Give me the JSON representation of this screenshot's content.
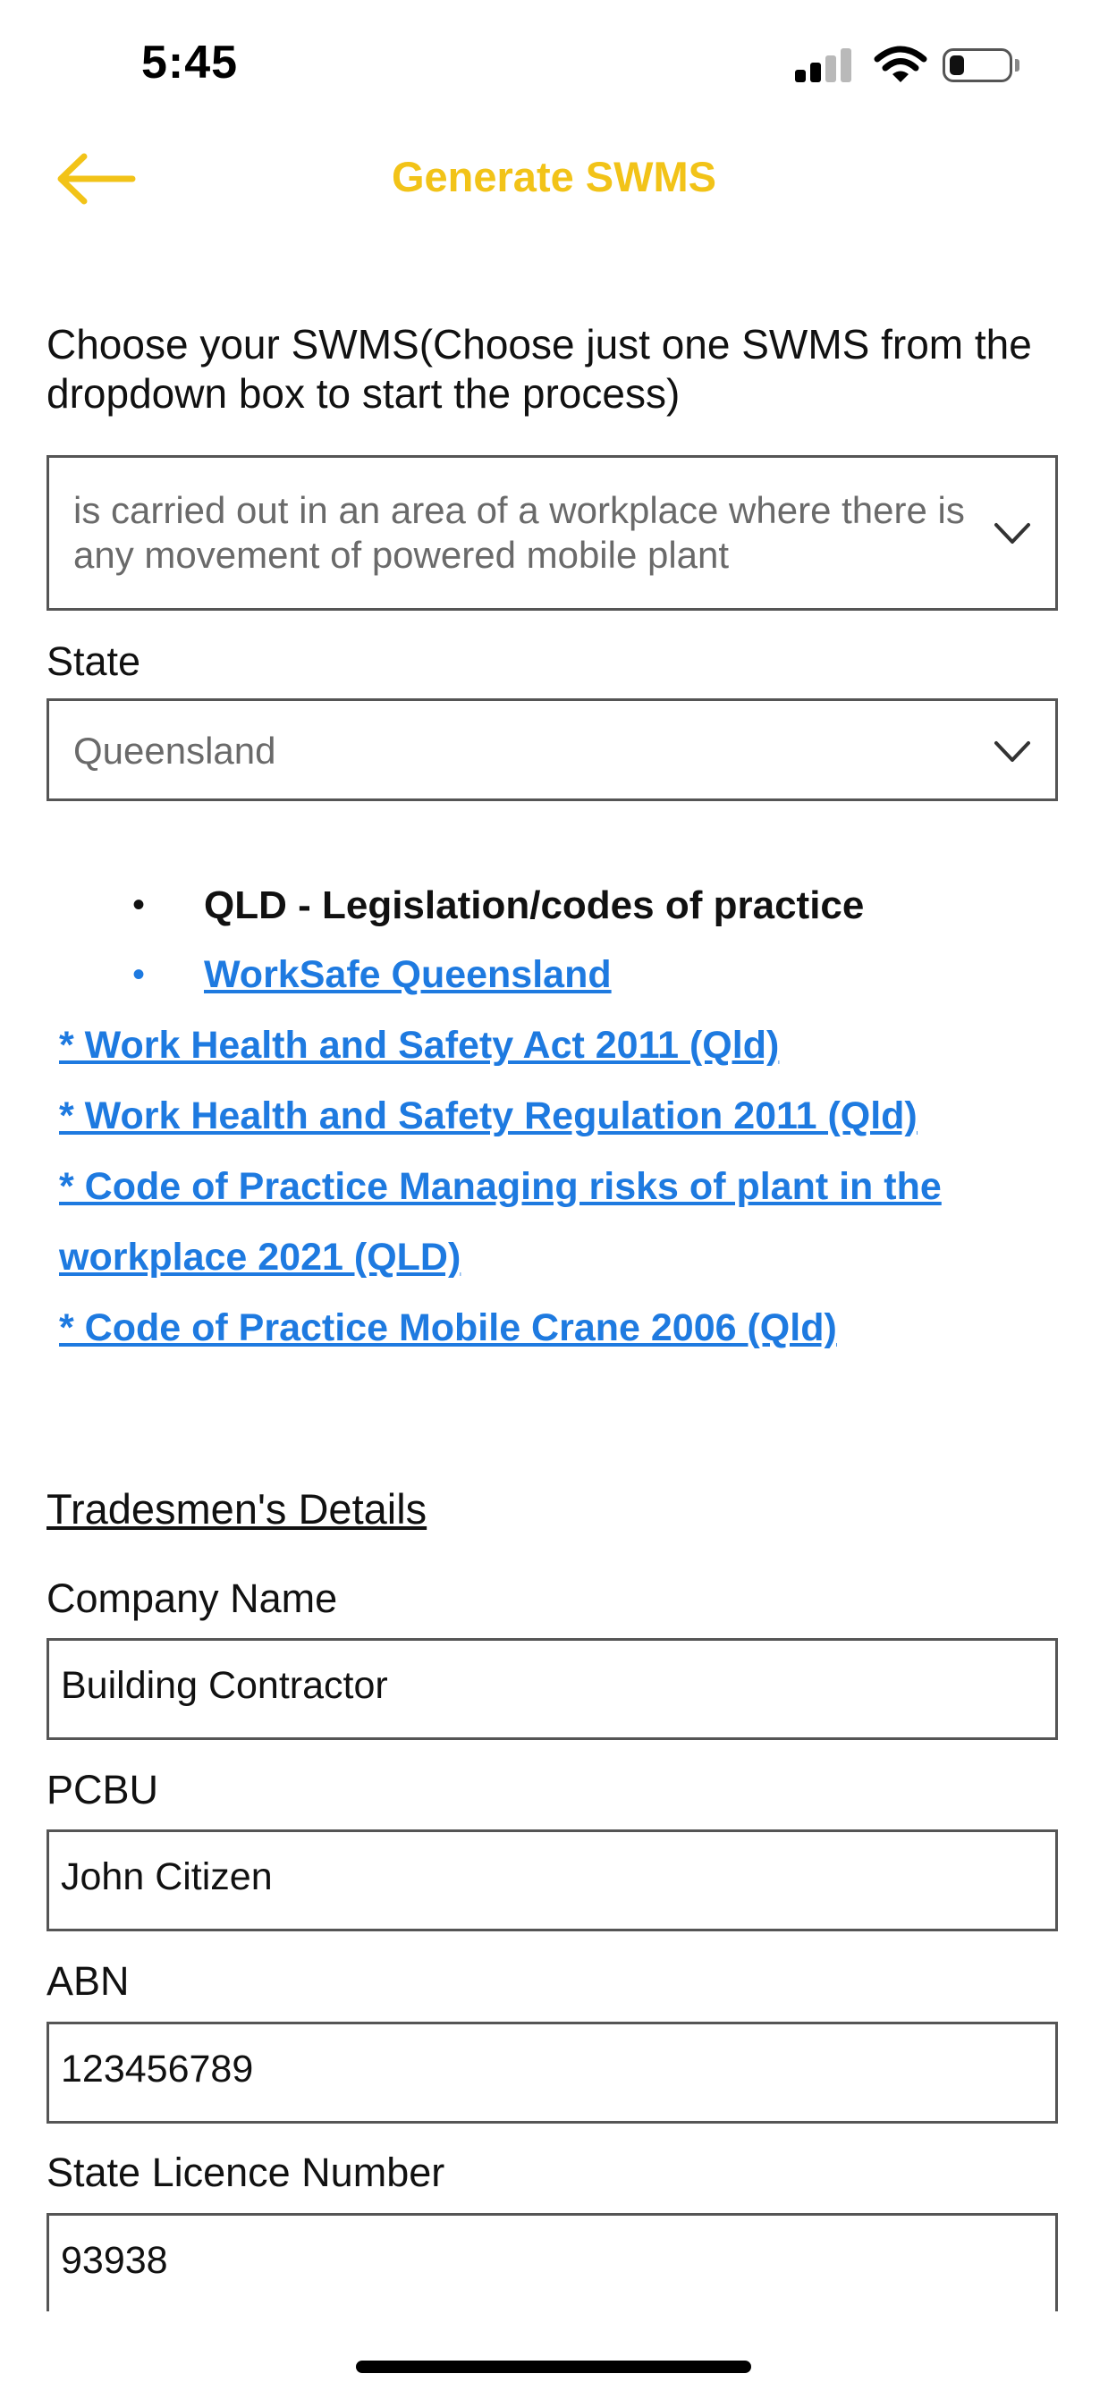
{
  "status_bar": {
    "time": "5:45",
    "icons": [
      "cellular-signal-icon",
      "wifi-icon",
      "battery-icon"
    ],
    "battery_level": 0.25,
    "signal_bars_active": 2,
    "signal_bars_total": 4
  },
  "header": {
    "title": "Generate SWMS",
    "back_icon": "arrow-left-icon",
    "accent_color": "#f2c318"
  },
  "intro": {
    "text": "Choose your SWMS(Choose just one SWMS from the dropdown box to start the process)"
  },
  "swms_select": {
    "line1": "is carried out in an area of a workplace where there is",
    "line2": "any movement of powered mobile plant",
    "icon": "chevron-down-icon"
  },
  "state": {
    "label": "State",
    "value": "Queensland",
    "icon": "chevron-down-icon"
  },
  "legislation": {
    "heading": "QLD - Legislation/codes of practice",
    "bullet": "•",
    "link_color": "#1e7ae0",
    "links": {
      "worksafe": "WorkSafe Queensland",
      "act": "* Work Health and Safety Act 2011 (Qld)",
      "regulation": "* Work Health and Safety Regulation 2011 (Qld)",
      "plant_line1": "* Code of Practice Managing risks of plant in the",
      "plant_line2": "workplace 2021 (QLD)",
      "crane": "* Code of Practice Mobile Crane 2006 (Qld)"
    }
  },
  "tradesmen": {
    "title": "Tradesmen's Details",
    "company_label": "Company Name",
    "company_value": "Building Contractor",
    "pcbu_label": "PCBU",
    "pcbu_value": "John Citizen",
    "abn_label": "ABN",
    "abn_value": "123456789",
    "licence_label": "State Licence Number",
    "licence_value": "93938"
  }
}
